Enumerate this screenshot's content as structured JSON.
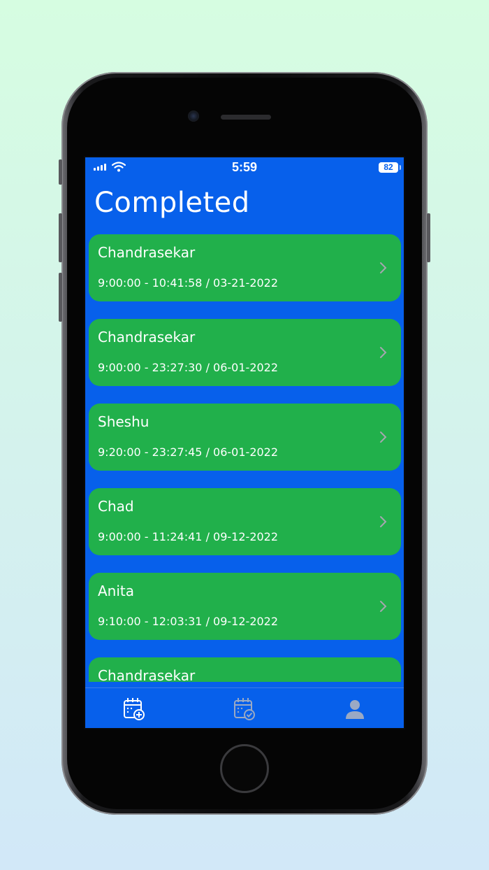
{
  "status_bar": {
    "time": "5:59",
    "battery": "82"
  },
  "page": {
    "title": "Completed"
  },
  "items": [
    {
      "name": "Chandrasekar",
      "detail": "9:00:00 - 10:41:58 / 03-21-2022"
    },
    {
      "name": "Chandrasekar",
      "detail": "9:00:00 - 23:27:30 / 06-01-2022"
    },
    {
      "name": "Sheshu",
      "detail": "9:20:00 - 23:27:45 / 06-01-2022"
    },
    {
      "name": "Chad",
      "detail": "9:00:00 - 11:24:41 / 09-12-2022"
    },
    {
      "name": "Anita",
      "detail": "9:10:00 - 12:03:31 / 09-12-2022"
    },
    {
      "name": "Chandrasekar",
      "detail": ""
    }
  ],
  "tabs": [
    {
      "icon": "calendar-add-icon",
      "active": true
    },
    {
      "icon": "calendar-check-icon",
      "active": false
    },
    {
      "icon": "person-icon",
      "active": false
    }
  ],
  "colors": {
    "background_top": "#d6fde1",
    "background_bottom": "#d2e8f8",
    "screen": "#0760eb",
    "card": "#21b04b",
    "tab_active": "#ffffff",
    "tab_inactive": "#9aa9c4"
  }
}
